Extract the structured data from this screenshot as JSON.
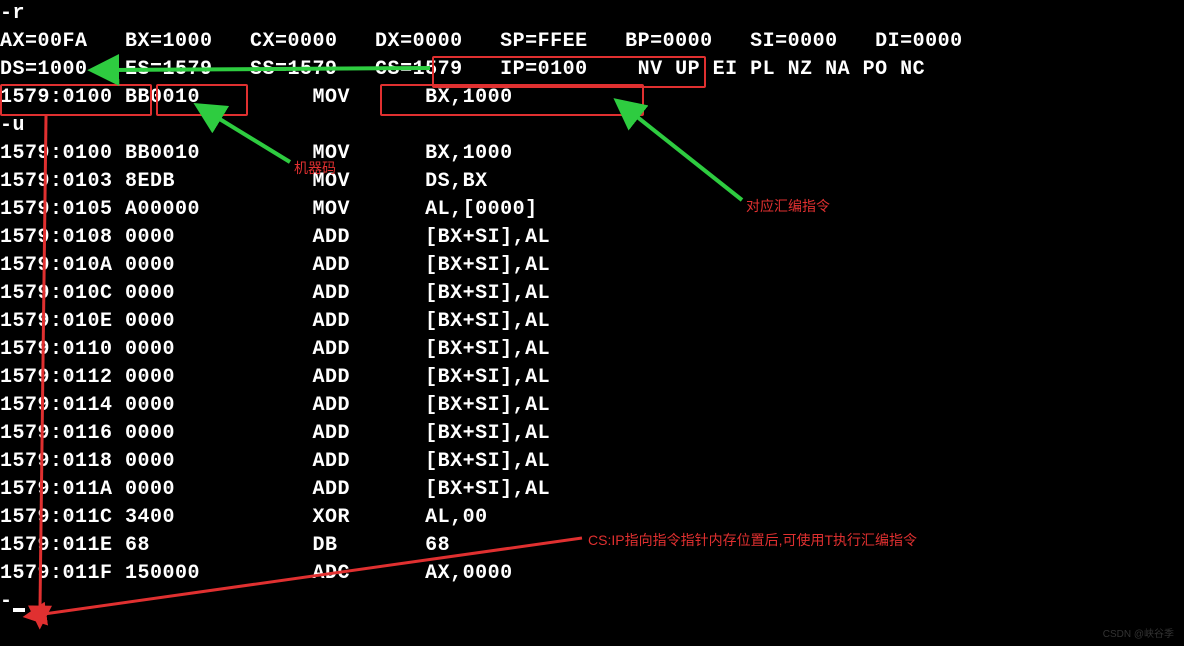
{
  "cmd_r": "-r",
  "regs1": "AX=00FA   BX=1000   CX=0000   DX=0000   SP=FFEE   BP=0000   SI=0000   DI=0000",
  "regs2": "DS=1000   ES=1579   SS=1579   CS=1579   IP=0100    NV UP EI PL NZ NA PO NC",
  "nextline": "1579:0100 BB0010         MOV      BX,1000",
  "cmd_u": "-u",
  "disasm": [
    "1579:0100 BB0010         MOV      BX,1000",
    "1579:0103 8EDB           MOV      DS,BX",
    "1579:0105 A00000         MOV      AL,[0000]",
    "1579:0108 0000           ADD      [BX+SI],AL",
    "1579:010A 0000           ADD      [BX+SI],AL",
    "1579:010C 0000           ADD      [BX+SI],AL",
    "1579:010E 0000           ADD      [BX+SI],AL",
    "1579:0110 0000           ADD      [BX+SI],AL",
    "1579:0112 0000           ADD      [BX+SI],AL",
    "1579:0114 0000           ADD      [BX+SI],AL",
    "1579:0116 0000           ADD      [BX+SI],AL",
    "1579:0118 0000           ADD      [BX+SI],AL",
    "1579:011A 0000           ADD      [BX+SI],AL",
    "1579:011C 3400           XOR      AL,00",
    "1579:011E 68             DB       68",
    "1579:011F 150000         ADC      AX,0000"
  ],
  "prompt": "-",
  "labels": {
    "machine_code": "机器码",
    "asm_instr": "对应汇编指令",
    "csip_note": "CS:IP指向指令指针内存位置后,可使用T执行汇编指令"
  },
  "watermark": "CSDN @峡谷季"
}
